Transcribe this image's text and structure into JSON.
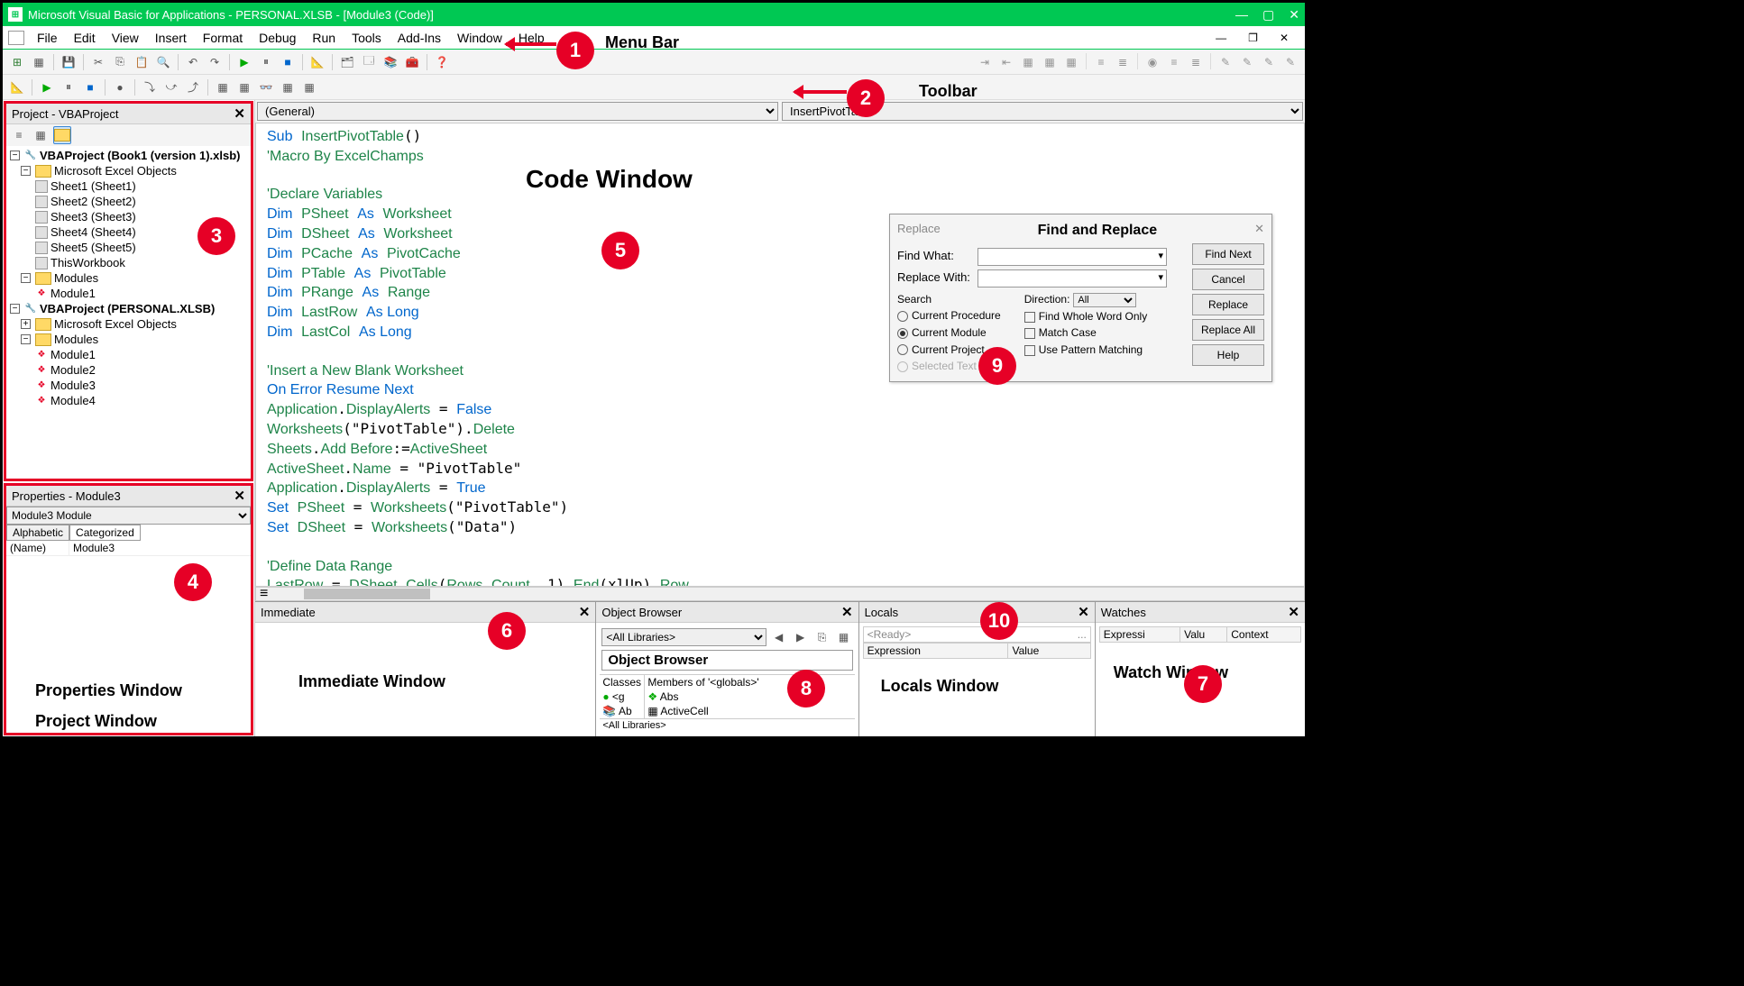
{
  "titlebar": {
    "title": "Microsoft Visual Basic for Applications - PERSONAL.XLSB - [Module3 (Code)]"
  },
  "menubar": {
    "items": [
      "File",
      "Edit",
      "View",
      "Insert",
      "Format",
      "Debug",
      "Run",
      "Tools",
      "Add-Ins",
      "Window",
      "Help"
    ]
  },
  "annotations": {
    "menu_bar": "Menu Bar",
    "toolbar": "Toolbar",
    "project_window": "Project Window",
    "properties_window": "Properties Window",
    "code_window": "Code Window",
    "immediate_window": "Immediate Window",
    "watch_window": "Watch Window",
    "object_browser": "Object Browser",
    "find_replace": "Find and Replace",
    "locals_window": "Locals Window",
    "numbers": [
      "1",
      "2",
      "3",
      "4",
      "5",
      "6",
      "7",
      "8",
      "9",
      "10"
    ]
  },
  "project": {
    "title": "Project - VBAProject",
    "tree": {
      "p1": "VBAProject (Book1 (version 1).xlsb)",
      "p1_excel": "Microsoft Excel Objects",
      "sheets": [
        "Sheet1 (Sheet1)",
        "Sheet2 (Sheet2)",
        "Sheet3 (Sheet3)",
        "Sheet4 (Sheet4)",
        "Sheet5 (Sheet5)",
        "ThisWorkbook"
      ],
      "p1_mod": "Modules",
      "p1_mods": [
        "Module1"
      ],
      "p2": "VBAProject (PERSONAL.XLSB)",
      "p2_excel": "Microsoft Excel Objects",
      "p2_mod": "Modules",
      "p2_mods": [
        "Module1",
        "Module2",
        "Module3",
        "Module4"
      ]
    }
  },
  "properties": {
    "title": "Properties - Module3",
    "selector": "Module3 Module",
    "tabs": [
      "Alphabetic",
      "Categorized"
    ],
    "name_key": "(Name)",
    "name_val": "Module3"
  },
  "code": {
    "left_dd": "(General)",
    "right_dd": "InsertPivotTable"
  },
  "replace": {
    "tab": "Replace",
    "find_what": "Find What:",
    "replace_with": "Replace With:",
    "search": "Search",
    "current_procedure": "Current Procedure",
    "current_module": "Current Module",
    "current_project": "Current Project",
    "selected_text": "Selected Text",
    "direction_lbl": "Direction:",
    "direction": "All",
    "whole_word": "Find Whole Word Only",
    "match_case": "Match Case",
    "pattern": "Use Pattern Matching",
    "btn_find_next": "Find Next",
    "btn_cancel": "Cancel",
    "btn_replace": "Replace",
    "btn_replace_all": "Replace All",
    "btn_help": "Help"
  },
  "bottom": {
    "immediate": "Immediate",
    "object_browser": "Object Browser",
    "locals": "Locals",
    "watches": "Watches",
    "all_libs": "<All Libraries>",
    "classes": "Classes",
    "members": "Members of '<globals>'",
    "abs": "Abs",
    "ab": "Ab",
    "activecell": "ActiveCell",
    "g": "<g",
    "ready": "<Ready>",
    "expression": "Expression",
    "value": "Value",
    "expressi": "Expressi",
    "valu": "Valu",
    "context": "Context"
  }
}
